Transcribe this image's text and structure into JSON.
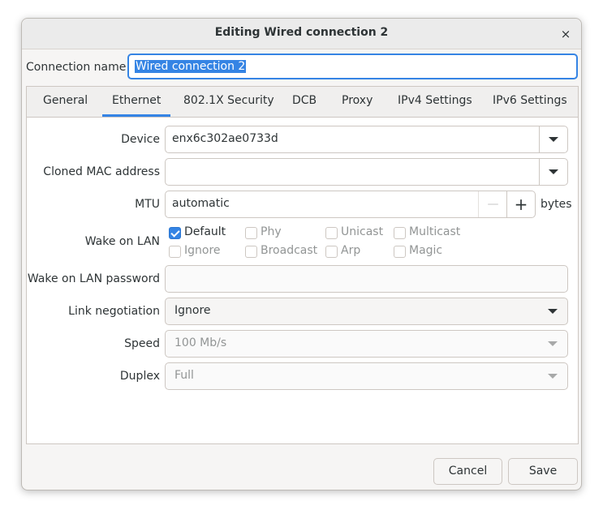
{
  "window": {
    "title": "Editing Wired connection 2",
    "close_glyph": "×"
  },
  "connection": {
    "label": "Connection name",
    "value": "Wired connection 2"
  },
  "tabs": [
    {
      "label": "General"
    },
    {
      "label": "Ethernet"
    },
    {
      "label": "802.1X Security"
    },
    {
      "label": "DCB"
    },
    {
      "label": "Proxy"
    },
    {
      "label": "IPv4 Settings"
    },
    {
      "label": "IPv6 Settings"
    }
  ],
  "active_tab": "Ethernet",
  "ethernet": {
    "device_label": "Device",
    "device_value": "enx6c302ae0733d",
    "mac_label": "Cloned MAC address",
    "mac_value": "",
    "mtu_label": "MTU",
    "mtu_value": "automatic",
    "mtu_minus": "—",
    "mtu_plus": "+",
    "mtu_unit": "bytes",
    "wol_label": "Wake on LAN",
    "wol_options": [
      {
        "label": "Default",
        "checked": true
      },
      {
        "label": "Phy",
        "checked": false
      },
      {
        "label": "Unicast",
        "checked": false
      },
      {
        "label": "Multicast",
        "checked": false
      },
      {
        "label": "Ignore",
        "checked": false
      },
      {
        "label": "Broadcast",
        "checked": false
      },
      {
        "label": "Arp",
        "checked": false
      },
      {
        "label": "Magic",
        "checked": false
      }
    ],
    "wol_password_label": "Wake on LAN password",
    "wol_password_value": "",
    "link_label": "Link negotiation",
    "link_value": "Ignore",
    "speed_label": "Speed",
    "speed_value": "100 Mb/s",
    "duplex_label": "Duplex",
    "duplex_value": "Full"
  },
  "buttons": {
    "cancel": "Cancel",
    "save": "Save"
  },
  "colors": {
    "accent": "#3584e4"
  }
}
